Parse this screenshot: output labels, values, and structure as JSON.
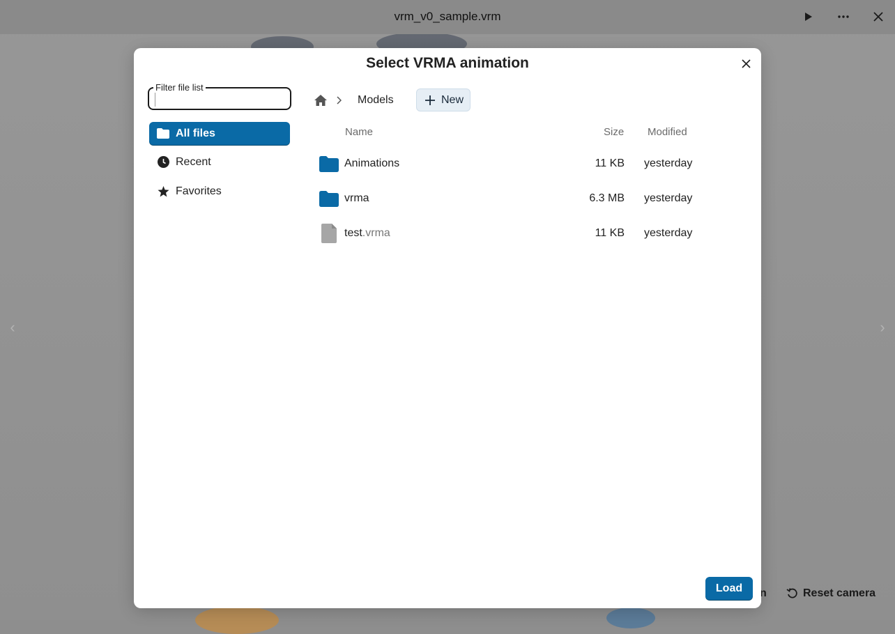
{
  "window": {
    "title": "vrm_v0_sample.vrm",
    "play_icon": "play-icon",
    "more_icon": "more-icon",
    "close_icon": "close-icon"
  },
  "background": {
    "partial_button_label": "n",
    "reset_camera_label": "Reset camera"
  },
  "dialog": {
    "title": "Select VRMA animation",
    "filter": {
      "label": "Filter file list",
      "value": "",
      "placeholder": ""
    },
    "nav": [
      {
        "label": "All files",
        "icon": "folder-icon",
        "active": true
      },
      {
        "label": "Recent",
        "icon": "clock-icon",
        "active": false
      },
      {
        "label": "Favorites",
        "icon": "star-icon",
        "active": false
      }
    ],
    "breadcrumb": {
      "home_icon": "home-icon",
      "current": "Models"
    },
    "new_button_label": "New",
    "columns": {
      "name": "Name",
      "size": "Size",
      "modified": "Modified"
    },
    "files": [
      {
        "name": "Animations",
        "ext": "",
        "type": "folder",
        "size": "11 KB",
        "modified": "yesterday"
      },
      {
        "name": "vrma",
        "ext": "",
        "type": "folder",
        "size": "6.3 MB",
        "modified": "yesterday"
      },
      {
        "name": "test",
        "ext": ".vrma",
        "type": "file",
        "size": "11 KB",
        "modified": "yesterday"
      }
    ],
    "load_button_label": "Load"
  },
  "colors": {
    "accent": "#0a6aa6",
    "folder": "#0a6aa6",
    "file": "#a6a6a6",
    "overlay": "#8e8e8e"
  }
}
